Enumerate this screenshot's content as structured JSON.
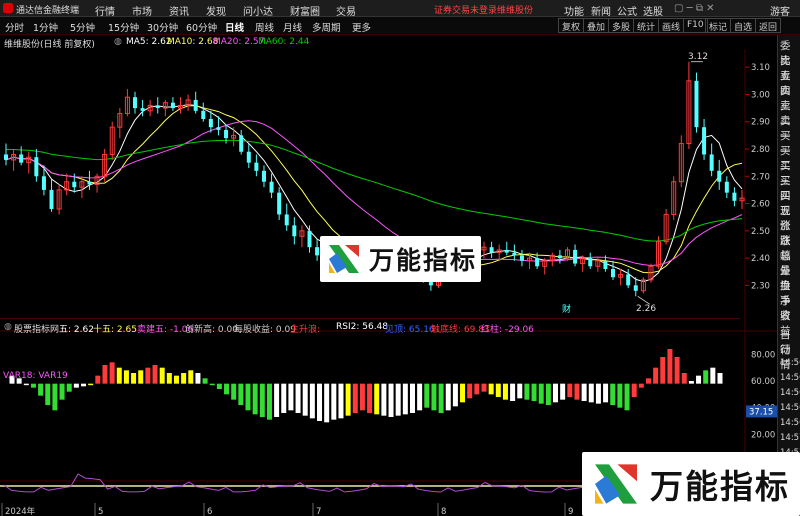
{
  "menubar": {
    "title": "通达信金融终端",
    "items": [
      "行情",
      "市场",
      "资讯",
      "发现",
      "问小达",
      "财富圈",
      "交易"
    ],
    "notice": "证券交易未登录",
    "stock_link": "维维股份",
    "right_items": [
      "功能",
      "新闻",
      "公式",
      "选股",
      "游客"
    ]
  },
  "toolbar": {
    "periods": [
      "分时",
      "1分钟",
      "5分钟",
      "15分钟",
      "30分钟",
      "60分钟",
      "日线",
      "周线",
      "月线",
      "多周期",
      "更多"
    ],
    "selected": "日线",
    "buttons": [
      "复权",
      "叠加",
      "多股",
      "统计",
      "画线",
      "F10",
      "标记",
      "自选",
      "返回"
    ]
  },
  "main_info": {
    "name": "维维股份(日线 前复权)",
    "ma5": "MA5: 2.62",
    "ma10": "MA10: 2.68",
    "ma20": "MA20: 2.57",
    "ma60": "MA60: 2.44"
  },
  "colors": {
    "up": "#ff3b3b",
    "down": "#54ffff",
    "ma5": "#ffffff",
    "ma10": "#ffff55",
    "ma20": "#ff55ff",
    "ma60": "#00cc00",
    "yellow": "#ffff00",
    "green": "#33dd33",
    "grid": "#4a0000"
  },
  "price_axis": {
    "ticks": [
      "3.10",
      "3.00",
      "2.90",
      "2.80",
      "2.70",
      "2.60",
      "2.50",
      "2.40",
      "2.30"
    ],
    "high_label": "3.12",
    "low_label": "2.26",
    "event_label": "财"
  },
  "indicator": {
    "title": "股票指标网",
    "wu": "五: 2.62",
    "shiwu": "十五: 2.65",
    "sell_point": "卖建五: -1.06",
    "new_high": "创新高: 0.00",
    "profit": "每股收益: 0.09",
    "main_rise": "主升浪:",
    "rsi2": "RSI2: 56.48",
    "peak": "见顶: 65.16",
    "bottom": "触底线: 69.83",
    "red_line": "红柱: -29.06",
    "var_label": "VAR18: VAR19",
    "axis_ticks": [
      "80.00",
      "60.00",
      "40.00",
      "20.00"
    ],
    "current_value": "37.15"
  },
  "side_tabs": [
    "委比",
    "卖五",
    "卖四",
    "卖三",
    "卖二",
    "卖一",
    "买一",
    "买二",
    "买三",
    "买四",
    "买五",
    "现价",
    "涨跌",
    "涨幅",
    "总量",
    "外盘",
    "换手",
    "净资",
    "收益"
  ],
  "side_tabs_lower": [
    "自动",
    "行情"
  ],
  "times": [
    "14:56",
    "14:56",
    "14:56",
    "14:56",
    "14:56",
    "14:57",
    "14:57"
  ],
  "date_axis": [
    "2024年",
    "5",
    "6",
    "7",
    "8",
    "9"
  ],
  "watermark": "万能指标",
  "chart_data": {
    "type": "candlestick",
    "ohlc": [
      [
        2.78,
        2.82,
        2.74,
        2.76
      ],
      [
        2.76,
        2.8,
        2.72,
        2.78
      ],
      [
        2.78,
        2.81,
        2.74,
        2.75
      ],
      [
        2.75,
        2.79,
        2.71,
        2.77
      ],
      [
        2.77,
        2.8,
        2.68,
        2.7
      ],
      [
        2.7,
        2.74,
        2.63,
        2.65
      ],
      [
        2.65,
        2.69,
        2.57,
        2.58
      ],
      [
        2.58,
        2.67,
        2.56,
        2.65
      ],
      [
        2.65,
        2.71,
        2.63,
        2.68
      ],
      [
        2.68,
        2.71,
        2.64,
        2.66
      ],
      [
        2.66,
        2.7,
        2.62,
        2.68
      ],
      [
        2.68,
        2.72,
        2.65,
        2.67
      ],
      [
        2.67,
        2.71,
        2.64,
        2.7
      ],
      [
        2.7,
        2.8,
        2.68,
        2.78
      ],
      [
        2.78,
        2.9,
        2.76,
        2.88
      ],
      [
        2.88,
        2.95,
        2.84,
        2.93
      ],
      [
        2.93,
        3.02,
        2.92,
        2.99
      ],
      [
        2.99,
        3.01,
        2.93,
        2.95
      ],
      [
        2.95,
        2.98,
        2.92,
        2.94
      ],
      [
        2.94,
        2.98,
        2.92,
        2.96
      ],
      [
        2.96,
        2.99,
        2.93,
        2.95
      ],
      [
        2.95,
        2.98,
        2.92,
        2.97
      ],
      [
        2.97,
        2.99,
        2.94,
        2.95
      ],
      [
        2.95,
        2.99,
        2.93,
        2.96
      ],
      [
        2.96,
        3.0,
        2.94,
        2.98
      ],
      [
        2.98,
        3.01,
        2.93,
        2.94
      ],
      [
        2.94,
        2.97,
        2.9,
        2.91
      ],
      [
        2.91,
        2.94,
        2.86,
        2.88
      ],
      [
        2.88,
        2.92,
        2.85,
        2.87
      ],
      [
        2.87,
        2.89,
        2.82,
        2.84
      ],
      [
        2.84,
        2.88,
        2.81,
        2.85
      ],
      [
        2.85,
        2.87,
        2.78,
        2.79
      ],
      [
        2.79,
        2.82,
        2.73,
        2.75
      ],
      [
        2.75,
        2.78,
        2.7,
        2.72
      ],
      [
        2.72,
        2.74,
        2.66,
        2.68
      ],
      [
        2.68,
        2.71,
        2.62,
        2.64
      ],
      [
        2.64,
        2.66,
        2.54,
        2.56
      ],
      [
        2.56,
        2.6,
        2.5,
        2.52
      ],
      [
        2.52,
        2.55,
        2.45,
        2.48
      ],
      [
        2.48,
        2.52,
        2.44,
        2.5
      ],
      [
        2.5,
        2.52,
        2.42,
        2.44
      ],
      [
        2.44,
        2.47,
        2.39,
        2.41
      ],
      [
        2.41,
        2.46,
        2.38,
        2.44
      ],
      [
        2.44,
        2.47,
        2.36,
        2.38
      ],
      [
        2.38,
        2.44,
        2.36,
        2.43
      ],
      [
        2.43,
        2.46,
        2.4,
        2.41
      ],
      [
        2.41,
        2.45,
        2.39,
        2.44
      ],
      [
        2.44,
        2.47,
        2.41,
        2.42
      ],
      [
        2.42,
        2.46,
        2.4,
        2.45
      ],
      [
        2.45,
        2.47,
        2.41,
        2.42
      ],
      [
        2.42,
        2.45,
        2.38,
        2.4
      ],
      [
        2.4,
        2.43,
        2.36,
        2.38
      ],
      [
        2.38,
        2.42,
        2.35,
        2.4
      ],
      [
        2.4,
        2.43,
        2.37,
        2.39
      ],
      [
        2.39,
        2.41,
        2.34,
        2.36
      ],
      [
        2.36,
        2.39,
        2.31,
        2.33
      ],
      [
        2.33,
        2.36,
        2.28,
        2.3
      ],
      [
        2.3,
        2.36,
        2.29,
        2.35
      ],
      [
        2.35,
        2.39,
        2.33,
        2.37
      ],
      [
        2.37,
        2.4,
        2.34,
        2.38
      ],
      [
        2.38,
        2.42,
        2.36,
        2.41
      ],
      [
        2.41,
        2.44,
        2.38,
        2.4
      ],
      [
        2.4,
        2.45,
        2.39,
        2.43
      ],
      [
        2.43,
        2.46,
        2.4,
        2.44
      ],
      [
        2.44,
        2.46,
        2.4,
        2.42
      ],
      [
        2.42,
        2.45,
        2.39,
        2.43
      ],
      [
        2.43,
        2.46,
        2.41,
        2.42
      ],
      [
        2.42,
        2.45,
        2.39,
        2.41
      ],
      [
        2.41,
        2.43,
        2.37,
        2.39
      ],
      [
        2.39,
        2.42,
        2.36,
        2.4
      ],
      [
        2.4,
        2.42,
        2.36,
        2.37
      ],
      [
        2.37,
        2.4,
        2.34,
        2.39
      ],
      [
        2.39,
        2.42,
        2.37,
        2.41
      ],
      [
        2.41,
        2.43,
        2.38,
        2.4
      ],
      [
        2.4,
        2.44,
        2.39,
        2.43
      ],
      [
        2.43,
        2.45,
        2.37,
        2.38
      ],
      [
        2.38,
        2.41,
        2.35,
        2.4
      ],
      [
        2.4,
        2.42,
        2.36,
        2.37
      ],
      [
        2.37,
        2.4,
        2.35,
        2.39
      ],
      [
        2.39,
        2.41,
        2.35,
        2.36
      ],
      [
        2.36,
        2.39,
        2.32,
        2.33
      ],
      [
        2.33,
        2.36,
        2.3,
        2.34
      ],
      [
        2.34,
        2.36,
        2.29,
        2.3
      ],
      [
        2.3,
        2.33,
        2.26,
        2.28
      ],
      [
        2.28,
        2.33,
        2.27,
        2.32
      ],
      [
        2.32,
        2.38,
        2.31,
        2.37
      ],
      [
        2.37,
        2.48,
        2.36,
        2.46
      ],
      [
        2.46,
        2.58,
        2.45,
        2.56
      ],
      [
        2.56,
        2.7,
        2.54,
        2.68
      ],
      [
        2.68,
        2.85,
        2.66,
        2.82
      ],
      [
        2.82,
        3.12,
        2.8,
        3.05
      ],
      [
        3.05,
        3.08,
        2.86,
        2.88
      ],
      [
        2.88,
        2.91,
        2.76,
        2.78
      ],
      [
        2.78,
        2.82,
        2.7,
        2.72
      ],
      [
        2.72,
        2.76,
        2.65,
        2.68
      ],
      [
        2.68,
        2.7,
        2.62,
        2.64
      ],
      [
        2.64,
        2.66,
        2.59,
        2.61
      ],
      [
        2.61,
        2.65,
        2.58,
        2.62
      ]
    ],
    "ma60_start": 2.8,
    "indicator_bars": [
      [
        64,
        "w"
      ],
      [
        62,
        "w"
      ],
      [
        58,
        "w"
      ],
      [
        55,
        "g"
      ],
      [
        49,
        "g"
      ],
      [
        42,
        "g"
      ],
      [
        38,
        "g"
      ],
      [
        46,
        "g"
      ],
      [
        52,
        "g"
      ],
      [
        55,
        "w"
      ],
      [
        56,
        "w"
      ],
      [
        58,
        "y"
      ],
      [
        64,
        "r"
      ],
      [
        72,
        "r"
      ],
      [
        74,
        "r"
      ],
      [
        70,
        "y"
      ],
      [
        68,
        "y"
      ],
      [
        66,
        "y"
      ],
      [
        68,
        "y"
      ],
      [
        70,
        "r"
      ],
      [
        72,
        "r"
      ],
      [
        70,
        "y"
      ],
      [
        66,
        "y"
      ],
      [
        64,
        "y"
      ],
      [
        66,
        "y"
      ],
      [
        68,
        "y"
      ],
      [
        66,
        "w"
      ],
      [
        62,
        "g"
      ],
      [
        58,
        "g"
      ],
      [
        54,
        "g"
      ],
      [
        50,
        "g"
      ],
      [
        46,
        "g"
      ],
      [
        42,
        "g"
      ],
      [
        38,
        "g"
      ],
      [
        35,
        "g"
      ],
      [
        33,
        "g"
      ],
      [
        31,
        "g"
      ],
      [
        33,
        "w"
      ],
      [
        36,
        "w"
      ],
      [
        38,
        "w"
      ],
      [
        36,
        "w"
      ],
      [
        34,
        "w"
      ],
      [
        32,
        "w"
      ],
      [
        30,
        "w"
      ],
      [
        29,
        "w"
      ],
      [
        31,
        "w"
      ],
      [
        32,
        "w"
      ],
      [
        34,
        "y"
      ],
      [
        36,
        "r"
      ],
      [
        38,
        "r"
      ],
      [
        36,
        "r"
      ],
      [
        35,
        "y"
      ],
      [
        34,
        "w"
      ],
      [
        33,
        "w"
      ],
      [
        34,
        "w"
      ],
      [
        35,
        "w"
      ],
      [
        36,
        "w"
      ],
      [
        38,
        "w"
      ],
      [
        40,
        "g"
      ],
      [
        38,
        "g"
      ],
      [
        36,
        "g"
      ],
      [
        38,
        "w"
      ],
      [
        41,
        "w"
      ],
      [
        44,
        "y"
      ],
      [
        47,
        "r"
      ],
      [
        50,
        "r"
      ],
      [
        52,
        "r"
      ],
      [
        50,
        "y"
      ],
      [
        48,
        "y"
      ],
      [
        46,
        "y"
      ],
      [
        45,
        "w"
      ],
      [
        47,
        "w"
      ],
      [
        46,
        "g"
      ],
      [
        45,
        "g"
      ],
      [
        43,
        "g"
      ],
      [
        42,
        "g"
      ],
      [
        44,
        "w"
      ],
      [
        46,
        "w"
      ],
      [
        48,
        "r"
      ],
      [
        46,
        "r"
      ],
      [
        45,
        "w"
      ],
      [
        44,
        "w"
      ],
      [
        43,
        "w"
      ],
      [
        44,
        "w"
      ],
      [
        42,
        "g"
      ],
      [
        40,
        "g"
      ],
      [
        38,
        "g"
      ],
      [
        48,
        "r"
      ],
      [
        55,
        "r"
      ],
      [
        62,
        "r"
      ],
      [
        70,
        "r"
      ],
      [
        78,
        "r"
      ],
      [
        84,
        "r"
      ],
      [
        78,
        "r"
      ],
      [
        66,
        "r"
      ],
      [
        60,
        "w"
      ],
      [
        64,
        "w"
      ],
      [
        68,
        "g"
      ],
      [
        70,
        "w"
      ],
      [
        66,
        "w"
      ]
    ]
  }
}
